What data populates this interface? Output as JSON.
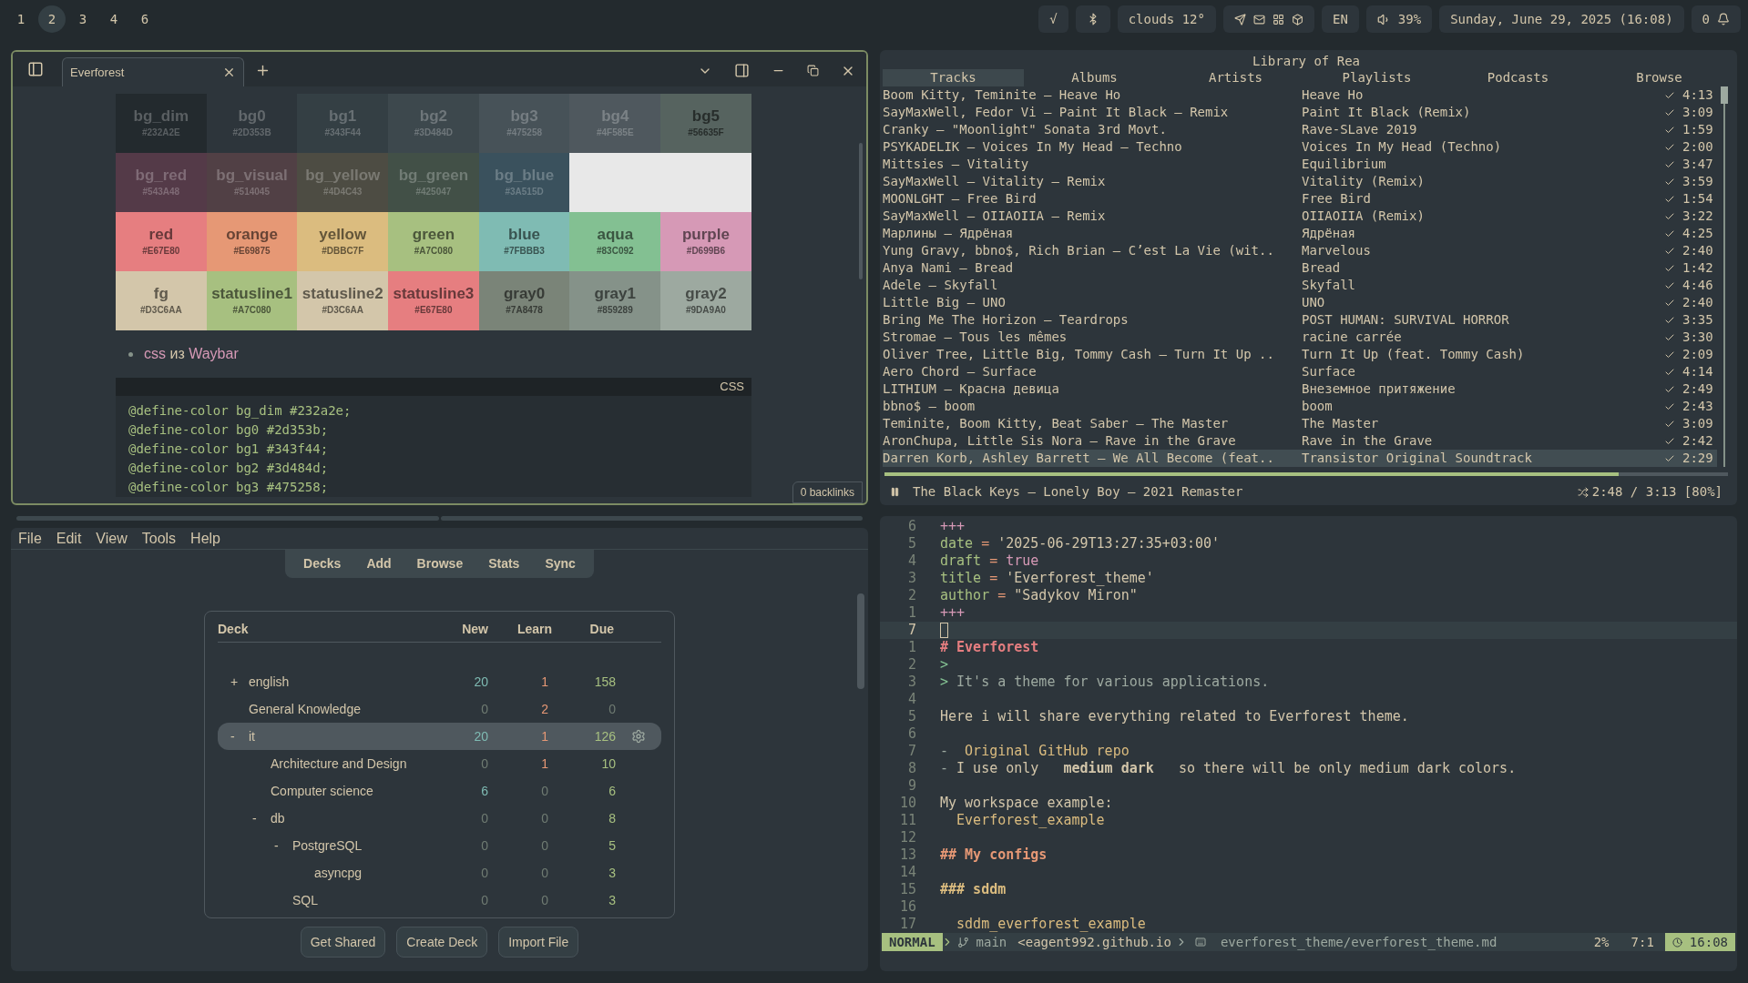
{
  "topbar": {
    "workspaces": [
      {
        "label": "1",
        "selected": false
      },
      {
        "label": "2",
        "selected": true
      },
      {
        "label": "3",
        "selected": false
      },
      {
        "label": "4",
        "selected": false
      },
      {
        "label": "6",
        "selected": false
      }
    ],
    "check": "√",
    "weather": "clouds 12°",
    "language": "EN",
    "volume": "39%",
    "clock": "Sunday, June 29, 2025 (16:08)",
    "notifications": "0"
  },
  "note_window": {
    "tab": "Everforest",
    "palette": [
      [
        {
          "name": "bg_dim",
          "hex": "#232A2E",
          "color": "#232a2e"
        },
        {
          "name": "bg0",
          "hex": "#2D353B",
          "color": "#2d353b"
        },
        {
          "name": "bg1",
          "hex": "#343F44",
          "color": "#343f44"
        },
        {
          "name": "bg2",
          "hex": "#3D484D",
          "color": "#3d484d"
        },
        {
          "name": "bg3",
          "hex": "#475258",
          "color": "#475258"
        },
        {
          "name": "bg4",
          "hex": "#4F585E",
          "color": "#4f585e"
        },
        {
          "name": "bg5",
          "hex": "#56635F",
          "color": "#56635f"
        }
      ],
      [
        {
          "name": "bg_red",
          "hex": "#543A48",
          "color": "#543a48"
        },
        {
          "name": "bg_visual",
          "hex": "#514045",
          "color": "#514045"
        },
        {
          "name": "bg_yellow",
          "hex": "#4D4C43",
          "color": "#4d4c43"
        },
        {
          "name": "bg_green",
          "hex": "#425047",
          "color": "#425047"
        },
        {
          "name": "bg_blue",
          "hex": "#3A515D",
          "color": "#3a515d"
        }
      ],
      [
        {
          "name": "red",
          "hex": "#E67E80",
          "color": "#e67e80"
        },
        {
          "name": "orange",
          "hex": "#E69875",
          "color": "#e69875"
        },
        {
          "name": "yellow",
          "hex": "#DBBC7F",
          "color": "#dbbc7f"
        },
        {
          "name": "green",
          "hex": "#A7C080",
          "color": "#a7c080"
        },
        {
          "name": "blue",
          "hex": "#7FBBB3",
          "color": "#7fbbb3"
        },
        {
          "name": "aqua",
          "hex": "#83C092",
          "color": "#83c092"
        },
        {
          "name": "purple",
          "hex": "#D699B6",
          "color": "#d699b6"
        }
      ],
      [
        {
          "name": "fg",
          "hex": "#D3C6AA",
          "color": "#d3c6aa"
        },
        {
          "name": "statusline1",
          "hex": "#A7C080",
          "color": "#a7c080"
        },
        {
          "name": "statusline2",
          "hex": "#D3C6AA",
          "color": "#d3c6aa"
        },
        {
          "name": "statusline3",
          "hex": "#E67E80",
          "color": "#e67e80"
        },
        {
          "name": "gray0",
          "hex": "#7A8478",
          "color": "#7a8478"
        },
        {
          "name": "gray1",
          "hex": "#859289",
          "color": "#859289"
        },
        {
          "name": "gray2",
          "hex": "#9DA9A0",
          "color": "#9da9a0"
        }
      ]
    ],
    "bullet": [
      {
        "kind": "link",
        "text": "css"
      },
      {
        "kind": "text",
        "text": "из"
      },
      {
        "kind": "link",
        "text": "Waybar"
      }
    ],
    "code": {
      "language": "CSS",
      "lines": [
        "@define-color bg_dim #232a2e;",
        "@define-color bg0 #2d353b;",
        "@define-color bg1 #343f44;",
        "@define-color bg2 #3d484d;",
        "@define-color bg3 #475258;"
      ]
    },
    "backlinks": "0 backlinks"
  },
  "player": {
    "title": "Library of Rea",
    "tabs": [
      {
        "label": "Tracks",
        "selected": true
      },
      {
        "label": "Albums",
        "selected": false
      },
      {
        "label": "Artists",
        "selected": false
      },
      {
        "label": "Playlists",
        "selected": false
      },
      {
        "label": "Podcasts",
        "selected": false
      },
      {
        "label": "Browse",
        "selected": false
      }
    ],
    "tracks": [
      {
        "title": "Boom Kitty, Teminite – Heave Ho",
        "album": "Heave Ho",
        "duration": "4:13",
        "saved": true,
        "selected": false
      },
      {
        "title": "SayMaxWell, Fedor Vi – Paint It Black – Remix",
        "album": "Paint It Black (Remix)",
        "duration": "3:09",
        "saved": true,
        "selected": false
      },
      {
        "title": "Cranky – \"Moonlight\" Sonata 3rd Movt.",
        "album": "Rave-SLave 2019",
        "duration": "1:59",
        "saved": true,
        "selected": false
      },
      {
        "title": "PSYKADELIK – Voices In My Head – Techno",
        "album": "Voices In My Head (Techno)",
        "duration": "2:00",
        "saved": true,
        "selected": false
      },
      {
        "title": "Mittsies – Vitality",
        "album": "Equilibrium",
        "duration": "3:47",
        "saved": true,
        "selected": false
      },
      {
        "title": "SayMaxWell – Vitality – Remix",
        "album": "Vitality (Remix)",
        "duration": "3:59",
        "saved": true,
        "selected": false
      },
      {
        "title": "MOONLGHT – Free Bird",
        "album": "Free Bird",
        "duration": "1:54",
        "saved": true,
        "selected": false
      },
      {
        "title": "SayMaxWell – OIIAOIIA – Remix",
        "album": "OIIAOIIA (Remix)",
        "duration": "3:22",
        "saved": true,
        "selected": false
      },
      {
        "title": "Марлины – Ядрёная",
        "album": "Ядрёная",
        "duration": "4:25",
        "saved": true,
        "selected": false
      },
      {
        "title": "Yung Gravy, bbno$, Rich Brian – C’est La Vie (wit..",
        "album": "Marvelous",
        "duration": "2:40",
        "saved": true,
        "selected": false
      },
      {
        "title": "Anya Nami – Bread",
        "album": "Bread",
        "duration": "1:42",
        "saved": true,
        "selected": false
      },
      {
        "title": "Adele – Skyfall",
        "album": "Skyfall",
        "duration": "4:46",
        "saved": true,
        "selected": false
      },
      {
        "title": "Little Big – UNO",
        "album": "UNO",
        "duration": "2:40",
        "saved": true,
        "selected": false
      },
      {
        "title": "Bring Me The Horizon – Teardrops",
        "album": "POST HUMAN: SURVIVAL HORROR",
        "duration": "3:35",
        "saved": true,
        "selected": false
      },
      {
        "title": "Stromae – Tous les mêmes",
        "album": "racine carrée",
        "duration": "3:30",
        "saved": true,
        "selected": false
      },
      {
        "title": "Oliver Tree, Little Big, Tommy Cash – Turn It Up ..",
        "album": "Turn It Up (feat. Tommy Cash)",
        "duration": "2:09",
        "saved": true,
        "selected": false
      },
      {
        "title": "Aero Chord – Surface",
        "album": "Surface",
        "duration": "4:14",
        "saved": true,
        "selected": false
      },
      {
        "title": "LITHIUM – Красна девица",
        "album": "Внеземное притяжение",
        "duration": "2:49",
        "saved": true,
        "selected": false
      },
      {
        "title": "bbno$ – boom",
        "album": "boom",
        "duration": "2:43",
        "saved": true,
        "selected": false
      },
      {
        "title": "Teminite, Boom Kitty, Beat Saber – The Master",
        "album": "The Master",
        "duration": "3:09",
        "saved": true,
        "selected": false
      },
      {
        "title": "AronChupa, Little Sis Nora – Rave in the Grave",
        "album": "Rave in the Grave",
        "duration": "2:42",
        "saved": true,
        "selected": false
      },
      {
        "title": "Darren Korb, Ashley Barrett – We All Become (feat..",
        "album": "Transistor Original Soundtrack",
        "duration": "2:29",
        "saved": true,
        "selected": true
      }
    ],
    "now_playing": {
      "track": "The Black Keys – Lonely Boy – 2021 Remaster",
      "time": "2:48 / 3:13 [80%]",
      "level": 0.87
    }
  },
  "anki": {
    "menu": [
      "File",
      "Edit",
      "View",
      "Tools",
      "Help"
    ],
    "toolbar": [
      "Decks",
      "Add",
      "Browse",
      "Stats",
      "Sync"
    ],
    "columns": [
      "Deck",
      "New",
      "Learn",
      "Due"
    ],
    "decks": [
      {
        "toggle": "+",
        "name": "english",
        "new": "20",
        "learn": "1",
        "due": "158",
        "selected": false
      },
      {
        "name": "General Knowledge",
        "new": "0",
        "learn": "2",
        "due": "0",
        "selected": false
      },
      {
        "toggle": "-",
        "name": "it",
        "new": "20",
        "learn": "1",
        "due": "126",
        "selected": true,
        "children": [
          {
            "name": "Architecture and Design",
            "new": "0",
            "learn": "1",
            "due": "10",
            "selected": false
          },
          {
            "name": "Computer science",
            "new": "6",
            "learn": "0",
            "due": "6",
            "selected": false
          },
          {
            "toggle": "-",
            "name": "db",
            "new": "0",
            "learn": "0",
            "due": "8",
            "selected": false,
            "children": [
              {
                "toggle": "-",
                "name": "PostgreSQL",
                "new": "0",
                "learn": "0",
                "due": "5",
                "selected": false,
                "children": [
                  {
                    "name": "asyncpg",
                    "new": "0",
                    "learn": "0",
                    "due": "3",
                    "selected": false
                  }
                ]
              },
              {
                "name": "SQL",
                "new": "0",
                "learn": "0",
                "due": "3",
                "selected": false
              }
            ]
          }
        ]
      }
    ],
    "buttons": [
      "Get Shared",
      "Create Deck",
      "Import File"
    ]
  },
  "editor": {
    "lines": [
      {
        "number": "6",
        "selected": false,
        "segments": [
          {
            "kind": "delim",
            "text": "+++"
          }
        ]
      },
      {
        "number": "5",
        "selected": false,
        "segments": [
          {
            "kind": "key",
            "text": "date"
          },
          {
            "kind": "op",
            "text": " = "
          },
          {
            "kind": "text",
            "text": "'2025-06-29T13:27:35+03:00'"
          }
        ]
      },
      {
        "number": "4",
        "selected": false,
        "segments": [
          {
            "kind": "key",
            "text": "draft"
          },
          {
            "kind": "op",
            "text": " = "
          },
          {
            "kind": "bool",
            "text": "true"
          }
        ]
      },
      {
        "number": "3",
        "selected": false,
        "segments": [
          {
            "kind": "key",
            "text": "title"
          },
          {
            "kind": "op",
            "text": " = "
          },
          {
            "kind": "text",
            "text": "'Everforest_theme'"
          }
        ]
      },
      {
        "number": "2",
        "selected": false,
        "segments": [
          {
            "kind": "key",
            "text": "author"
          },
          {
            "kind": "op",
            "text": " = "
          },
          {
            "kind": "text",
            "text": "\"Sadykov Miron\""
          }
        ]
      },
      {
        "number": "1",
        "selected": false,
        "segments": [
          {
            "kind": "delim",
            "text": "+++"
          }
        ]
      },
      {
        "number": "7",
        "selected": true
      },
      {
        "number": "1",
        "selected": false,
        "segments": [
          {
            "kind": "h1",
            "text": "# Everforest"
          }
        ]
      },
      {
        "number": "2",
        "selected": false,
        "segments": [
          {
            "kind": "quote",
            "text": ">"
          }
        ]
      },
      {
        "number": "3",
        "selected": false,
        "segments": [
          {
            "kind": "quote",
            "text": "> "
          },
          {
            "kind": "muted",
            "text": "It's a theme for various applications."
          }
        ]
      },
      {
        "number": "4",
        "selected": false
      },
      {
        "number": "5",
        "selected": false,
        "segments": [
          {
            "kind": "text",
            "text": "Here i will share everything related to Everforest theme."
          }
        ]
      },
      {
        "number": "6",
        "selected": false
      },
      {
        "number": "7",
        "selected": false,
        "segments": [
          {
            "kind": "marker",
            "text": "-  "
          },
          {
            "kind": "link",
            "text": "Original GitHub repo"
          }
        ]
      },
      {
        "number": "8",
        "selected": false,
        "segments": [
          {
            "kind": "marker",
            "text": "- "
          },
          {
            "kind": "text",
            "text": "I use only   "
          },
          {
            "kind": "bold",
            "text": "medium dark"
          },
          {
            "kind": "text",
            "text": "   so there will be only medium dark colors."
          }
        ]
      },
      {
        "number": "9",
        "selected": false
      },
      {
        "number": "10",
        "selected": false,
        "segments": [
          {
            "kind": "text",
            "text": "My workspace example:"
          }
        ]
      },
      {
        "number": "11",
        "selected": false,
        "segments": [
          {
            "kind": "link",
            "text": "  Everforest_example"
          }
        ]
      },
      {
        "number": "12",
        "selected": false
      },
      {
        "number": "13",
        "selected": false,
        "segments": [
          {
            "kind": "h2",
            "text": "## My configs"
          }
        ]
      },
      {
        "number": "14",
        "selected": false
      },
      {
        "number": "15",
        "selected": false,
        "segments": [
          {
            "kind": "h3",
            "text": "### sddm"
          }
        ]
      },
      {
        "number": "16",
        "selected": false
      },
      {
        "number": "17",
        "selected": false,
        "segments": [
          {
            "kind": "link",
            "text": "  sddm_everforest_example"
          }
        ]
      }
    ],
    "status": {
      "mode": "NORMAL",
      "branch": "main",
      "host": "<eagent992.github.io",
      "path": "everforest_theme/everforest_theme.md",
      "percent": "2%",
      "position": "7:1",
      "time": "16:08"
    }
  }
}
